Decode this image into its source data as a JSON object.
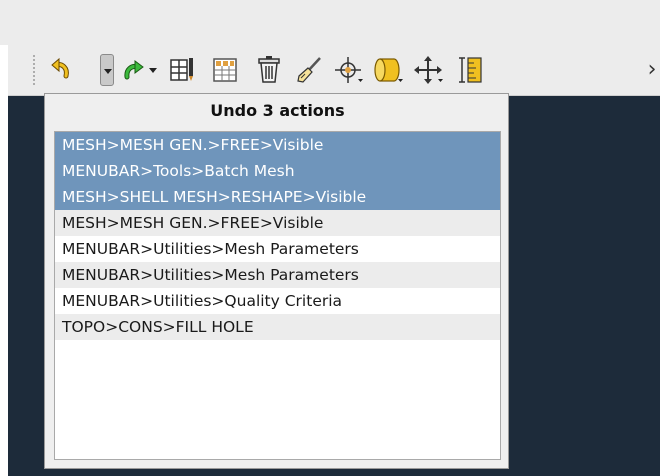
{
  "toolbar": {
    "buttons": [
      {
        "name": "undo-button",
        "icon": "undo-icon"
      },
      {
        "name": "undo-history-dropdown",
        "icon": "chevron-down-icon"
      },
      {
        "name": "redo-button",
        "icon": "redo-icon"
      },
      {
        "name": "redo-history-dropdown",
        "icon": "chevron-down-icon"
      },
      {
        "name": "table-tool-button",
        "icon": "table-pencil-icon"
      },
      {
        "name": "grid-panel-button",
        "icon": "grid-panel-icon"
      },
      {
        "name": "delete-button",
        "icon": "trash-icon"
      },
      {
        "name": "clean-button",
        "icon": "brush-icon"
      },
      {
        "name": "crosshair-button",
        "icon": "crosshair-icon"
      },
      {
        "name": "cylinder-button",
        "icon": "cylinder-icon"
      },
      {
        "name": "move-button",
        "icon": "move-arrows-icon"
      },
      {
        "name": "measure-button",
        "icon": "ruler-icon"
      }
    ],
    "overflow_glyph": "›",
    "accent": "#6f95bb"
  },
  "undo_popup": {
    "title": "Undo 3 actions",
    "selected_count": 3,
    "items": [
      {
        "label": "MESH>MESH GEN.>FREE>Visible",
        "selected": true
      },
      {
        "label": "MENUBAR>Tools>Batch Mesh",
        "selected": true
      },
      {
        "label": "MESH>SHELL MESH>RESHAPE>Visible",
        "selected": true
      },
      {
        "label": "MESH>MESH GEN.>FREE>Visible",
        "selected": false
      },
      {
        "label": "MENUBAR>Utilities>Mesh Parameters",
        "selected": false
      },
      {
        "label": "MENUBAR>Utilities>Mesh Parameters",
        "selected": false
      },
      {
        "label": "MENUBAR>Utilities>Quality Criteria",
        "selected": false
      },
      {
        "label": "TOPO>CONS>FILL HOLE",
        "selected": false
      }
    ]
  }
}
